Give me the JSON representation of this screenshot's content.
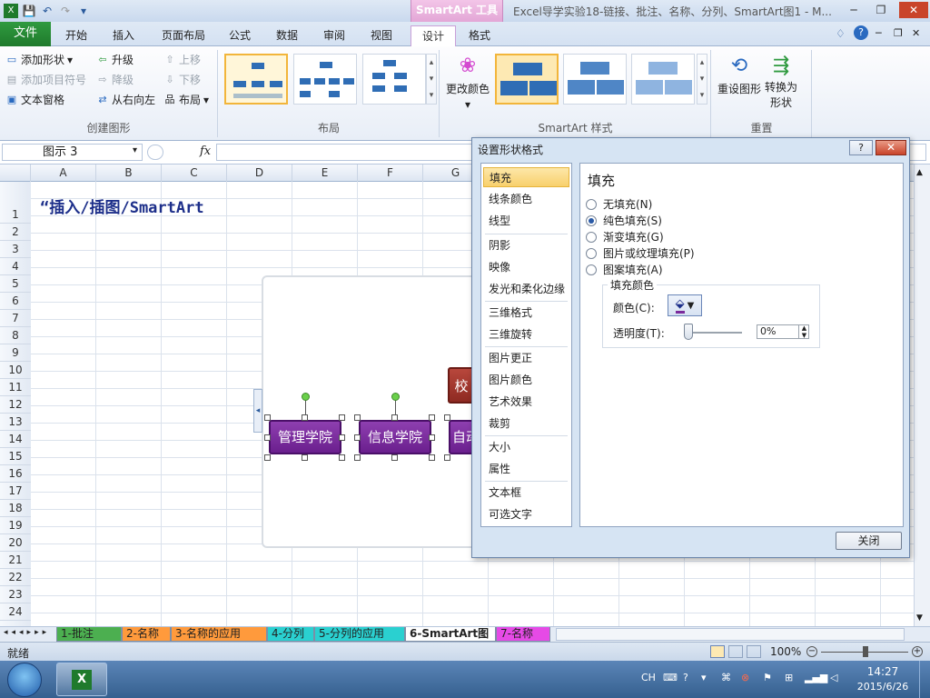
{
  "window": {
    "context_tab": "SmartArt 工具",
    "title": "Excel导学实验18-链接、批注、名称、分列、SmartArt图1 - M...",
    "controls": [
      "─",
      "❐",
      "✕"
    ]
  },
  "tabs": [
    "开始",
    "插入",
    "页面布局",
    "公式",
    "数据",
    "审阅",
    "视图",
    "设计",
    "格式"
  ],
  "file_tab": "文件",
  "ribbon": {
    "create_group": {
      "label": "创建图形",
      "add_shape": "添加形状",
      "add_bullet": "添加项目符号",
      "text_pane": "文本窗格",
      "promote": "升级",
      "demote": "降级",
      "rtl": "从右向左",
      "move_up": "上移",
      "move_down": "下移",
      "layout": "布局"
    },
    "layout_group": {
      "label": "布局"
    },
    "style_group": {
      "label": "SmartArt 样式",
      "change_colors": "更改颜色"
    },
    "reset_group": {
      "label": "重置",
      "reset_graphic": "重设图形",
      "convert": "转换为",
      "convert2": "形状"
    }
  },
  "formula_bar": {
    "name_box": "图示 3",
    "fx": "fx"
  },
  "columns": [
    "A",
    "B",
    "C",
    "D",
    "E",
    "F",
    "G"
  ],
  "rows": [
    "1",
    "2",
    "3",
    "4",
    "5",
    "6",
    "7",
    "8",
    "9",
    "10",
    "11",
    "12",
    "13",
    "14",
    "15",
    "16",
    "17",
    "18",
    "19",
    "20",
    "21",
    "22",
    "23",
    "24"
  ],
  "cell_a1": "“插入/插图/SmartArt",
  "smartart": {
    "nodes": [
      "管理学院",
      "信息学院",
      "自动"
    ],
    "top_node": "校"
  },
  "dialog": {
    "title": "设置形状格式",
    "help": "?",
    "close": "✕",
    "categories": [
      "填充",
      "线条颜色",
      "线型",
      "阴影",
      "映像",
      "发光和柔化边缘",
      "三维格式",
      "三维旋转",
      "图片更正",
      "图片颜色",
      "艺术效果",
      "裁剪",
      "大小",
      "属性",
      "文本框",
      "可选文字"
    ],
    "section_title": "填充",
    "options": [
      "无填充(N)",
      "纯色填充(S)",
      "渐变填充(G)",
      "图片或纹理填充(P)",
      "图案填充(A)"
    ],
    "selected_option_index": 1,
    "fill_color_label": "填充颜色",
    "color_label": "颜色(C):",
    "transparency_label": "透明度(T):",
    "transparency_value": "0%",
    "close_button": "关闭"
  },
  "sheet_tabs": [
    {
      "label": "1-批注",
      "color": "#4caf50"
    },
    {
      "label": "2-名称",
      "color": "#ff9a3c"
    },
    {
      "label": "3-名称的应用",
      "color": "#ff9a3c"
    },
    {
      "label": "4-分列",
      "color": "#2ad0d0"
    },
    {
      "label": "5-分列的应用",
      "color": "#2ad0d0"
    },
    {
      "label": "6-SmartArt图",
      "color": "#ffffff"
    },
    {
      "label": "7-名称",
      "color": "#e64ae6"
    }
  ],
  "status": {
    "ready": "就绪",
    "zoom": "100%"
  },
  "taskbar": {
    "lang": "CH",
    "time": "14:27",
    "date": "2015/6/26"
  }
}
